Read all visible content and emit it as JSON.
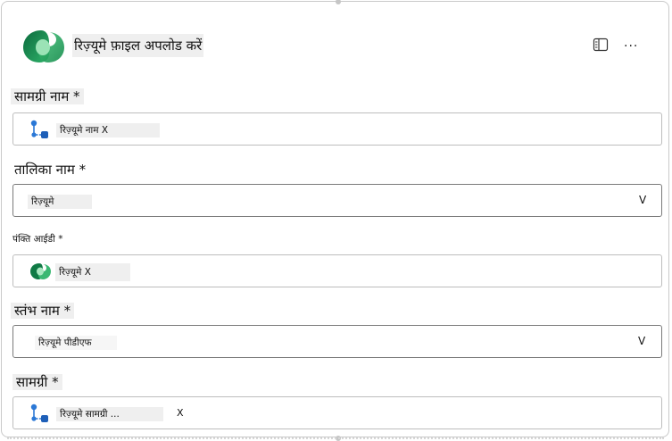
{
  "header": {
    "title": "रिज़्यूमे फ़ाइल अपलोड करें",
    "more_label": "...",
    "brand_color": "#1e8a4f"
  },
  "fields": {
    "content_name": {
      "label": "सामग्री नाम *",
      "token": "रिज़्यूमे नाम X",
      "icon": "flow-icon"
    },
    "table_name": {
      "label": "तालिका नाम *",
      "value": "रिज़्यूमे",
      "chevron": "V"
    },
    "row_id": {
      "label": "पंक्ति आईडी *",
      "token": "रिज़्यूमे X",
      "icon": "dataverse-icon"
    },
    "column_name": {
      "label": "स्तंभ नाम *",
      "value": "रिज़्यूमे पीडीएफ",
      "chevron": "V"
    },
    "content": {
      "label": "सामग्री *",
      "token": "रिज़्यूमे सामग्री ...",
      "remove": "X",
      "icon": "flow-icon"
    }
  }
}
